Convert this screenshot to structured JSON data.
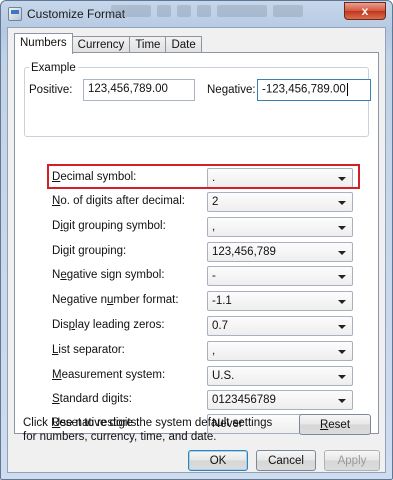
{
  "window": {
    "title": "Customize Format",
    "close_label": "x"
  },
  "tabs": [
    {
      "label": "Numbers",
      "active": true
    },
    {
      "label": "Currency",
      "active": false
    },
    {
      "label": "Time",
      "active": false
    },
    {
      "label": "Date",
      "active": false
    }
  ],
  "example": {
    "group_label": "Example",
    "positive_label": "Positive:",
    "positive_value": "123,456,789.00",
    "negative_label": "Negative:",
    "negative_value": "-123,456,789.00"
  },
  "settings": [
    {
      "label_pre": "",
      "label_ul": "D",
      "label_post": "ecimal symbol:",
      "value": "."
    },
    {
      "label_pre": "",
      "label_ul": "N",
      "label_post": "o. of digits after decimal:",
      "value": "2"
    },
    {
      "label_pre": "D",
      "label_ul": "i",
      "label_post": "git grouping symbol:",
      "value": ","
    },
    {
      "label_pre": "Di",
      "label_ul": "g",
      "label_post": "it grouping:",
      "value": "123,456,789"
    },
    {
      "label_pre": "N",
      "label_ul": "e",
      "label_post": "gative sign symbol:",
      "value": "-"
    },
    {
      "label_pre": "Negative n",
      "label_ul": "u",
      "label_post": "mber format:",
      "value": "-1.1"
    },
    {
      "label_pre": "Dis",
      "label_ul": "p",
      "label_post": "lay leading zeros:",
      "value": "0.7"
    },
    {
      "label_pre": "",
      "label_ul": "L",
      "label_post": "ist separator:",
      "value": ","
    },
    {
      "label_pre": "",
      "label_ul": "M",
      "label_post": "easurement system:",
      "value": "U.S."
    },
    {
      "label_pre": "",
      "label_ul": "S",
      "label_post": "tandard digits:",
      "value": "0123456789"
    },
    {
      "label_pre": "",
      "label_ul": "U",
      "label_post": "se native digits:",
      "value": "Never"
    }
  ],
  "reset": {
    "text": "Click Reset to restore the system default settings for numbers, currency, time, and date.",
    "button_ul": "R",
    "button_rest": "eset"
  },
  "buttons": {
    "ok": "OK",
    "cancel": "Cancel",
    "apply": "Apply"
  },
  "colors": {
    "highlight": "#d31f27",
    "window_frame": "#b5c9e2"
  }
}
